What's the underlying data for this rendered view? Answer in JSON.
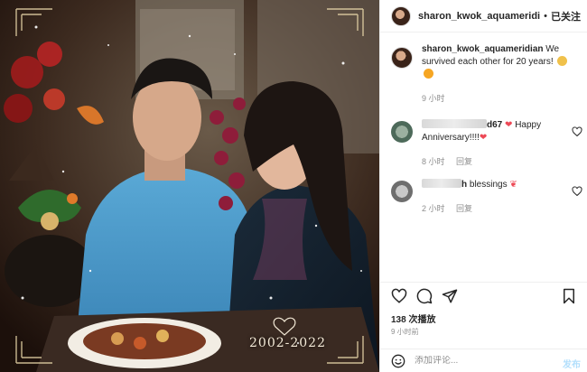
{
  "post": {
    "photo": {
      "alt_icon": "photo",
      "watermark_text": "2002-2022"
    }
  },
  "header": {
    "username": "sharon_kwok_aquameridi",
    "separator": "•",
    "follow_state": "已关注"
  },
  "caption": {
    "username": "sharon_kwok_aquameridian",
    "text": "We survived each other for 20 years!",
    "time": "9 小时"
  },
  "comments": [
    {
      "username_visible": "d67",
      "text": "Happy Anniversary!!!!",
      "time": "8 小时",
      "reply": "回复"
    },
    {
      "username_visible": "h",
      "text": "blessings",
      "time": "2 小时",
      "reply": "回复"
    }
  ],
  "actions": {
    "views": "138 次播放",
    "posted": "9 小时前"
  },
  "composer": {
    "placeholder": "添加评论...",
    "post_label": "发布"
  },
  "colors": {
    "accent_heart": "#ed4956",
    "text": "#262626",
    "muted": "#8e8e8e",
    "post_disabled": "#b2dffc"
  }
}
